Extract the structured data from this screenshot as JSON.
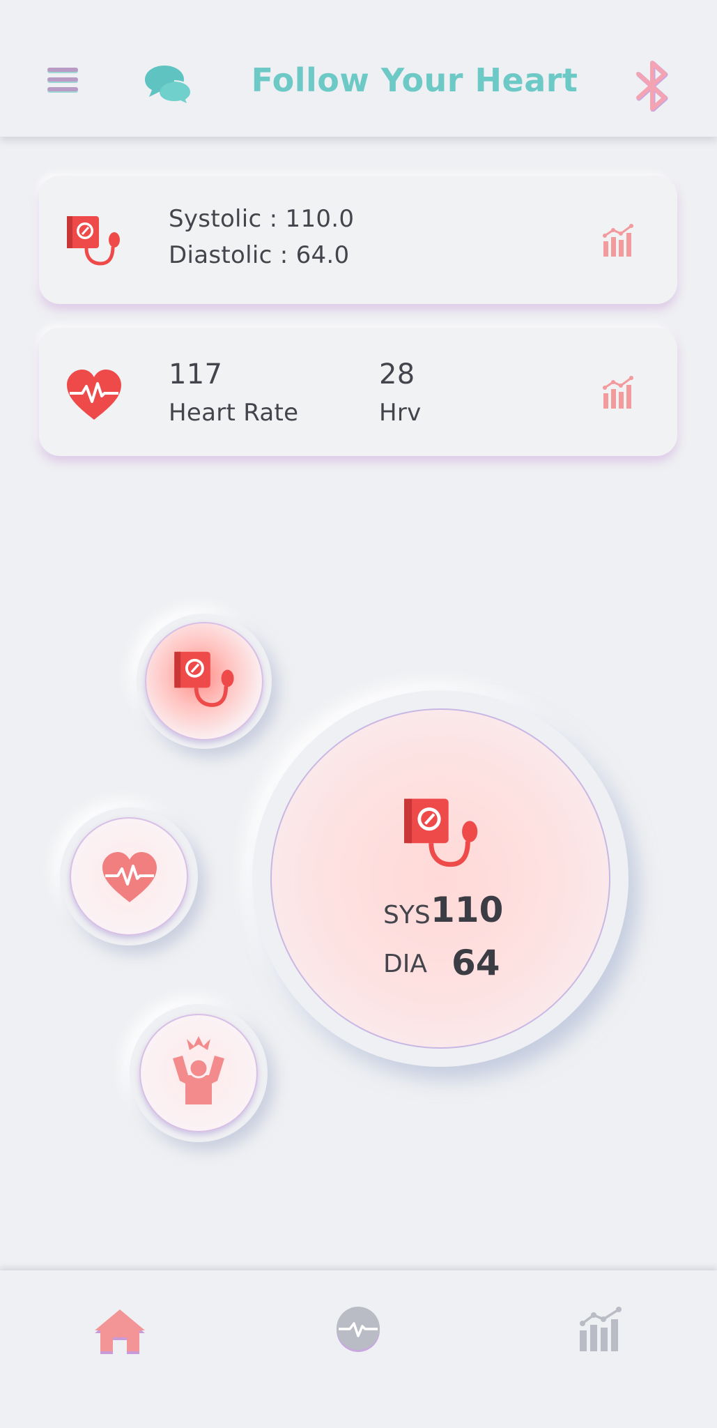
{
  "header": {
    "title": "Follow Your Heart",
    "icons": [
      "menu-icon",
      "chat-bubbles-icon",
      "bluetooth-icon"
    ]
  },
  "cards": {
    "blood_pressure": {
      "icon": "blood-pressure-monitor-icon",
      "systolic_text": "Systolic : 110.0",
      "diastolic_text": "Diastolic : 64.0",
      "action_icon": "bar-chart-icon"
    },
    "heart": {
      "icon": "heart-pulse-icon",
      "heart_rate_value": "117",
      "heart_rate_label": "Heart Rate",
      "hrv_value": "28",
      "hrv_label": "Hrv",
      "action_icon": "bar-chart-icon"
    }
  },
  "modes": [
    {
      "name": "blood-pressure",
      "icon": "blood-pressure-monitor-icon",
      "active": true
    },
    {
      "name": "heart-rate",
      "icon": "heart-pulse-icon",
      "active": false
    },
    {
      "name": "stress",
      "icon": "stressed-person-icon",
      "active": false
    }
  ],
  "reading": {
    "sys_label": "SYS",
    "sys_value": "110",
    "dia_label": "DIA",
    "dia_value": "64"
  },
  "bottom_nav": {
    "items": [
      {
        "name": "home",
        "icon": "home-icon",
        "active": true
      },
      {
        "name": "monitor",
        "icon": "pulse-monitor-icon",
        "active": false
      },
      {
        "name": "stats",
        "icon": "bar-chart-icon",
        "active": false
      }
    ]
  },
  "colors": {
    "background": "#eff0f3",
    "title_teal": "#6cc9c6",
    "accent_red": "#ee4a4a",
    "accent_pink": "#f29a9c",
    "lavender": "#c9b7e3",
    "text_dark": "#44444c"
  }
}
